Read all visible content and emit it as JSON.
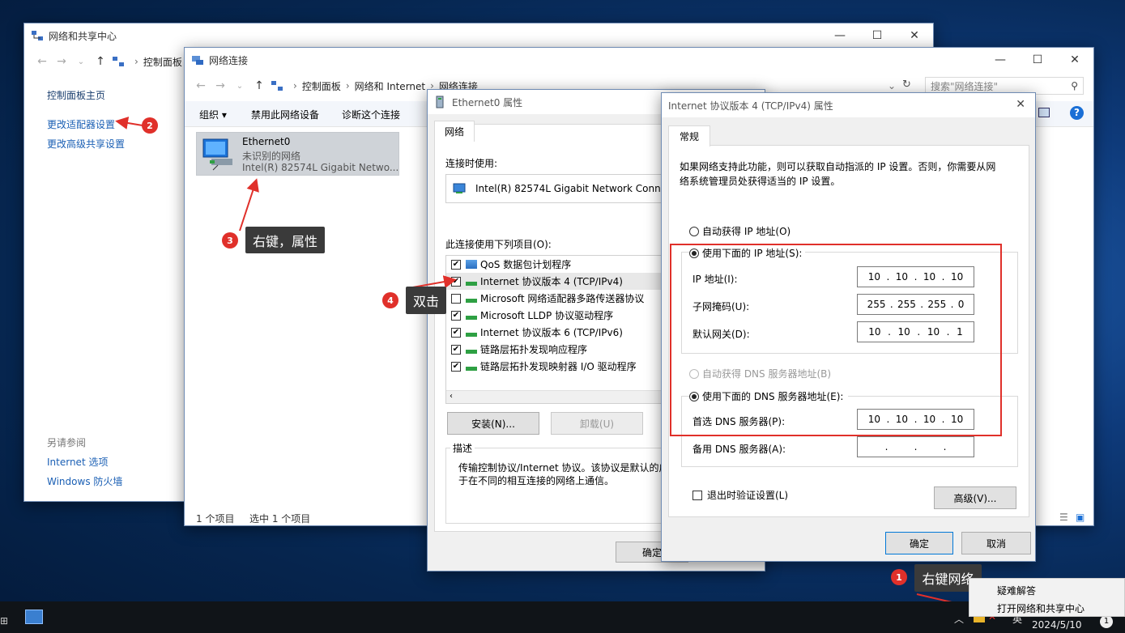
{
  "network_center": {
    "title": "网络和共享中心",
    "breadcrumb": "控制面板",
    "sidebar_home": "控制面板主页",
    "change_adapter": "更改适配器设置",
    "change_sharing": "更改高级共享设置",
    "see_also": "另请参阅",
    "internet_options": "Internet 选项",
    "firewall": "Windows 防火墙"
  },
  "net_connections": {
    "title": "网络连接",
    "breadcrumb": [
      "控制面板",
      "网络和 Internet",
      "网络连接"
    ],
    "search_placeholder": "搜索\"网络连接\"",
    "toolbar": {
      "organize": "组织 ▾",
      "disable": "禁用此网络设备",
      "diagnose": "诊断这个连接"
    },
    "adapter": {
      "name": "Ethernet0",
      "status": "未识别的网络",
      "device": "Intel(R) 82574L Gigabit Netwo..."
    },
    "status_count": "1 个项目",
    "status_selected": "选中 1 个项目"
  },
  "eth_props": {
    "title": "Ethernet0 属性",
    "tab": "网络",
    "connect_using_label": "连接时使用:",
    "adapter_name": "Intel(R) 82574L Gigabit Network Conne",
    "items_label": "此连接使用下列项目(O):",
    "items": [
      {
        "label": "QoS 数据包计划程序",
        "checked": true
      },
      {
        "label": "Internet 协议版本 4 (TCP/IPv4)",
        "checked": true
      },
      {
        "label": "Microsoft 网络适配器多路传送器协议",
        "checked": false
      },
      {
        "label": "Microsoft LLDP 协议驱动程序",
        "checked": true
      },
      {
        "label": "Internet 协议版本 6 (TCP/IPv6)",
        "checked": true
      },
      {
        "label": "链路层拓扑发现响应程序",
        "checked": true
      },
      {
        "label": "链路层拓扑发现映射器 I/O 驱动程序",
        "checked": true
      }
    ],
    "install": "安装(N)...",
    "uninstall": "卸载(U)",
    "desc_label": "描述",
    "desc_text_1": "传输控制协议/Internet 协议。该协议是默认的广",
    "desc_text_2": "于在不同的相互连接的网络上通信。",
    "ok": "确定"
  },
  "ipv4": {
    "title": "Internet 协议版本 4 (TCP/IPv4) 属性",
    "tab": "常规",
    "intro_1": "如果网络支持此功能，则可以获取自动指派的 IP 设置。否则，你需要从网",
    "intro_2": "络系统管理员处获得适当的 IP 设置。",
    "auto_ip": "自动获得 IP 地址(O)",
    "manual_ip": "使用下面的 IP 地址(S):",
    "ip_label": "IP 地址(I):",
    "ip": [
      "10",
      "10",
      "10",
      "10"
    ],
    "mask_label": "子网掩码(U):",
    "mask": [
      "255",
      "255",
      "255",
      "0"
    ],
    "gw_label": "默认网关(D):",
    "gw": [
      "10",
      "10",
      "10",
      "1"
    ],
    "auto_dns": "自动获得 DNS 服务器地址(B)",
    "manual_dns": "使用下面的 DNS 服务器地址(E):",
    "dns1_label": "首选 DNS 服务器(P):",
    "dns1": [
      "10",
      "10",
      "10",
      "10"
    ],
    "dns2_label": "备用 DNS 服务器(A):",
    "validate": "退出时验证设置(L)",
    "advanced": "高级(V)...",
    "ok": "确定",
    "cancel": "取消"
  },
  "annotations": {
    "n1": "1",
    "t1": "右键网络",
    "n2": "2",
    "n3": "3",
    "t3": "右键，属性",
    "n4": "4",
    "t4": "双击"
  },
  "context_menu": {
    "troubleshoot": "疑难解答",
    "open_center": "打开网络和共享中心"
  },
  "taskbar": {
    "date": "2024/5/10",
    "lang": "英",
    "notif": "1"
  },
  "colors": {
    "accent": "#0078d7",
    "annotation": "#e0302a"
  }
}
